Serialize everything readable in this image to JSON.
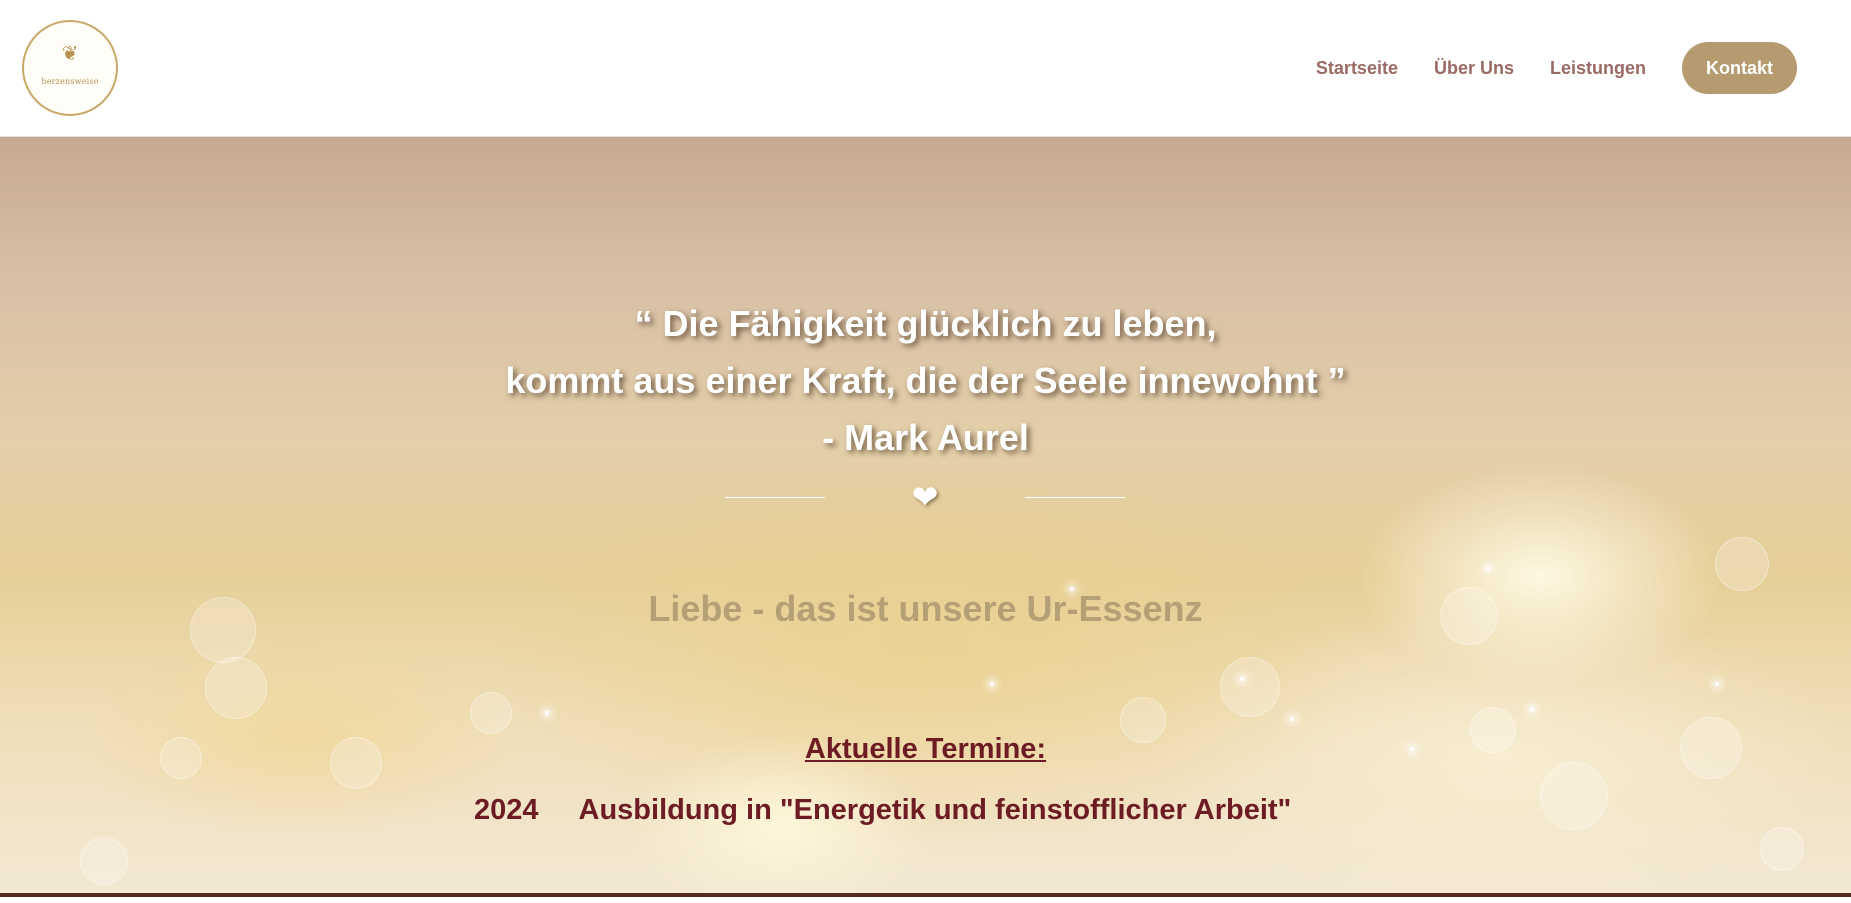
{
  "header": {
    "logo": {
      "text": "herzensweise",
      "icon": "double-heart-icon"
    },
    "nav": {
      "items": [
        {
          "label": "Startseite"
        },
        {
          "label": "Über Uns"
        },
        {
          "label": "Leistungen"
        }
      ],
      "cta_label": "Kontakt"
    }
  },
  "hero": {
    "quote_lines": [
      "“ Die Fähigkeit glücklich zu leben,",
      "kommt aus einer Kraft, die der Seele innewohnt ”",
      "- Mark Aurel"
    ],
    "divider_icon": "heart-icon",
    "tagline": "Liebe - das ist unsere Ur-Essenz",
    "events_heading": "Aktuelle Termine:",
    "events": [
      {
        "year": "2024",
        "title": "Ausbildung in \"Energetik und feinstofflicher Arbeit\""
      }
    ]
  },
  "colors": {
    "accent_gold": "#b59b6f",
    "nav_text": "#9a6a64",
    "events_text": "#6e1c24",
    "tagline_text": "#b5a075"
  }
}
